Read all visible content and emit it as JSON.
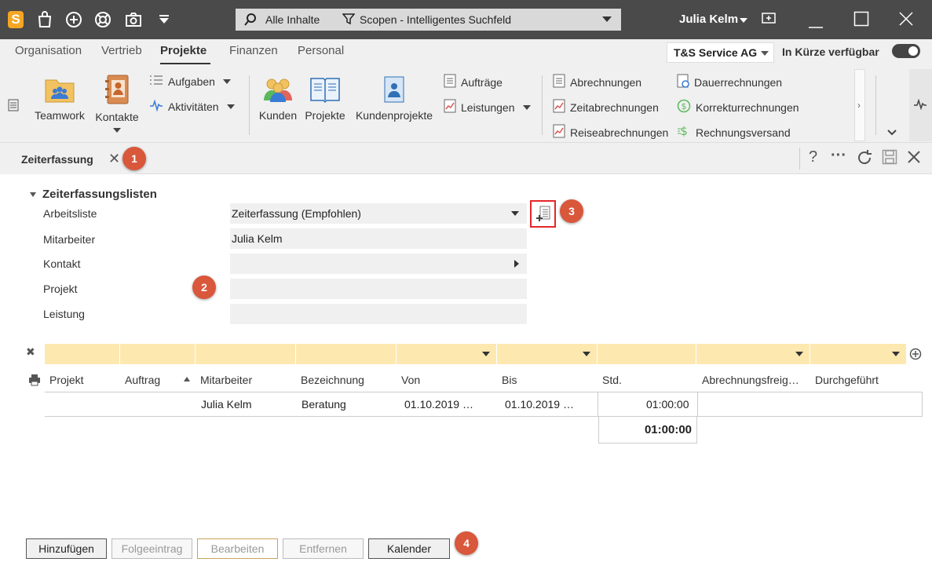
{
  "titlebar": {
    "logo_letter": "S",
    "search_scope_label": "Alle Inhalte",
    "search_placeholder": "Scopen - Intelligentes Suchfeld",
    "user_name": "Julia Kelm"
  },
  "nav": {
    "tabs": [
      "Organisation",
      "Vertrieb",
      "Projekte",
      "Finanzen",
      "Personal"
    ],
    "active_tab": "Projekte",
    "company": "T&S Service AG",
    "availability_label": "In Kürze verfügbar"
  },
  "ribbon": {
    "teamwork": "Teamwork",
    "kontakte": "Kontakte",
    "aufgaben": "Aufgaben",
    "aktivitaeten": "Aktivitäten",
    "kunden": "Kunden",
    "projekte": "Projekte",
    "kundenprojekte": "Kundenprojekte",
    "auftraege": "Aufträge",
    "leistungen": "Leistungen",
    "abrechnungen": "Abrechnungen",
    "zeitabrechnungen": "Zeitabrechnungen",
    "reiseabrechnungen": "Reiseabrechnungen",
    "dauerrechnungen": "Dauerrechnungen",
    "korrekturrechnungen": "Korrekturrechnungen",
    "rechnungsversand": "Rechnungsversand"
  },
  "doc": {
    "tab_label": "Zeiterfassung",
    "help": "?",
    "more": "···"
  },
  "badges": [
    "1",
    "2",
    "3",
    "4"
  ],
  "form": {
    "section_title": "Zeiterfassungslisten",
    "fields": {
      "arbeitsliste_label": "Arbeitsliste",
      "arbeitsliste_value": "Zeiterfassung (Empfohlen)",
      "mitarbeiter_label": "Mitarbeiter",
      "mitarbeiter_value": "Julia Kelm",
      "kontakt_label": "Kontakt",
      "kontakt_value": "",
      "projekt_label": "Projekt",
      "projekt_value": "",
      "leistung_label": "Leistung",
      "leistung_value": ""
    }
  },
  "grid": {
    "columns": [
      "Projekt",
      "Auftrag",
      "Mitarbeiter",
      "Bezeichnung",
      "Von",
      "Bis",
      "Std.",
      "Abrechnungsfreig…",
      "Durchgeführt"
    ],
    "rows": [
      {
        "projekt": "",
        "auftrag": "",
        "mitarbeiter": "Julia Kelm",
        "bezeichnung": "Beratung",
        "von": "01.10.2019 …",
        "bis": "01.10.2019 …",
        "std": "01:00:00",
        "abrechnungsfreigabe": "",
        "durchgefuehrt": ""
      }
    ],
    "sum_std": "01:00:00"
  },
  "buttons": {
    "hinzufuegen": "Hinzufügen",
    "folgeeintrag": "Folgeeintrag",
    "bearbeiten": "Bearbeiten",
    "entfernen": "Entfernen",
    "kalender": "Kalender"
  },
  "colors": {
    "titlebar_bg": "#4a4a4a",
    "badge": "#d9573b",
    "filter_row": "#fde8b0",
    "highlight_border": "#e3262c",
    "logo": "#f5a623"
  }
}
